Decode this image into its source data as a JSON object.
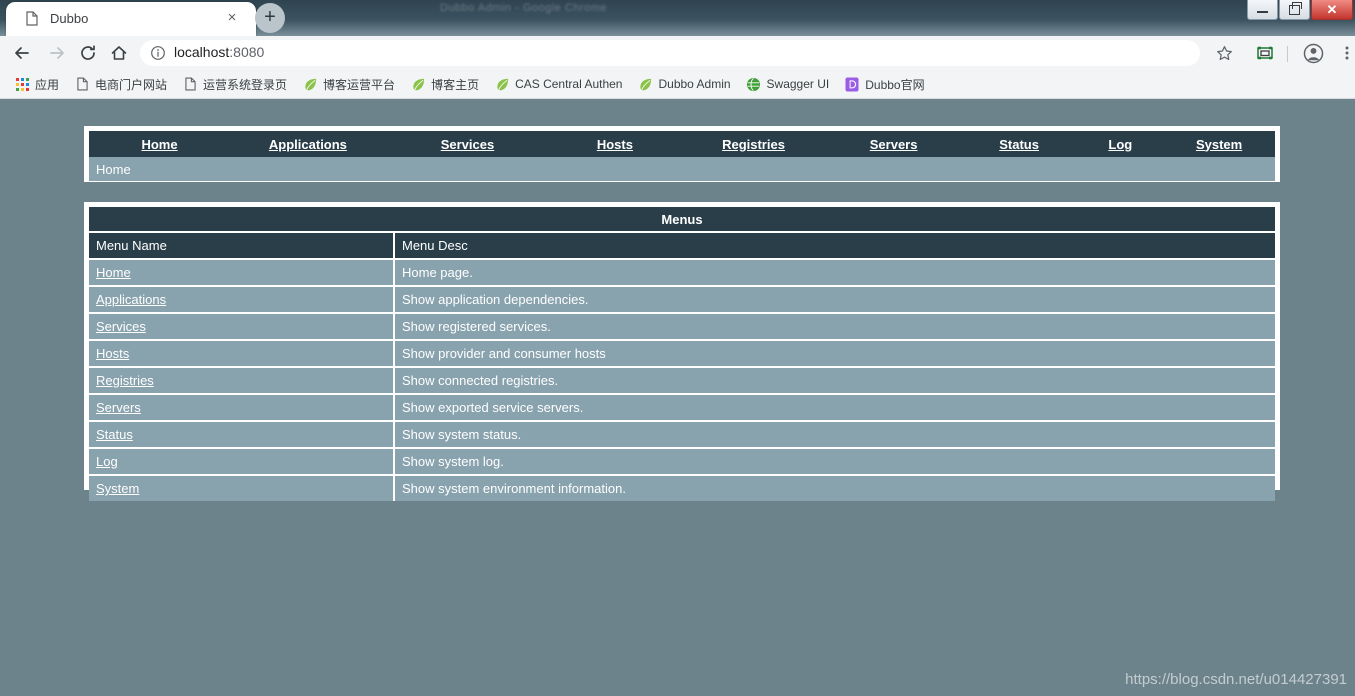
{
  "browser": {
    "tab": {
      "title": "Dubbo",
      "favicon": "page-icon",
      "close_label": "×"
    },
    "new_tab_label": "+",
    "window_controls": {
      "minimize": "minimize",
      "restore": "restore",
      "close": "✕"
    },
    "toolbar": {
      "back": "back-arrow",
      "forward": "forward-arrow",
      "reload": "reload",
      "home": "home",
      "star": "bookmark-star",
      "cast": "cast",
      "profile": "profile-avatar",
      "menu": "three-dot-menu"
    },
    "omnibox": {
      "host": "localhost",
      "port": ":8080",
      "full_url": "localhost:8080",
      "security_icon": "info-circle"
    },
    "bookmarks": [
      {
        "label": "应用",
        "icon": "apps-grid-icon"
      },
      {
        "label": "电商门户网站",
        "icon": "page-icon"
      },
      {
        "label": "运营系统登录页",
        "icon": "page-icon"
      },
      {
        "label": "博客运营平台",
        "icon": "leaf-icon"
      },
      {
        "label": "博客主页",
        "icon": "leaf-icon"
      },
      {
        "label": "CAS Central Authen",
        "icon": "leaf-icon"
      },
      {
        "label": "Dubbo Admin",
        "icon": "leaf-icon"
      },
      {
        "label": "Swagger UI",
        "icon": "swagger-icon"
      },
      {
        "label": "Dubbo官网",
        "icon": "dubbo-icon"
      }
    ]
  },
  "page": {
    "nav": [
      {
        "label": "Home"
      },
      {
        "label": "Applications"
      },
      {
        "label": "Services"
      },
      {
        "label": "Hosts"
      },
      {
        "label": "Registries"
      },
      {
        "label": "Servers"
      },
      {
        "label": "Status"
      },
      {
        "label": "Log"
      },
      {
        "label": "System"
      }
    ],
    "breadcrumb": "Home",
    "menus_panel": {
      "title": "Menus",
      "columns": [
        "Menu Name",
        "Menu Desc"
      ],
      "rows": [
        {
          "name": "Home",
          "desc": "Home page."
        },
        {
          "name": "Applications",
          "desc": "Show application dependencies."
        },
        {
          "name": "Services",
          "desc": "Show registered services."
        },
        {
          "name": "Hosts",
          "desc": "Show provider and consumer hosts"
        },
        {
          "name": "Registries",
          "desc": "Show connected registries."
        },
        {
          "name": "Servers",
          "desc": "Show exported service servers."
        },
        {
          "name": "Status",
          "desc": "Show system status."
        },
        {
          "name": "Log",
          "desc": "Show system log."
        },
        {
          "name": "System",
          "desc": "Show system environment information."
        }
      ]
    },
    "watermark": "https://blog.csdn.net/u014427391"
  },
  "colors": {
    "page_background": "#6d838b",
    "panel_dark": "#2a3e4a",
    "row_background": "#88a2ae",
    "border": "#ffffff"
  }
}
